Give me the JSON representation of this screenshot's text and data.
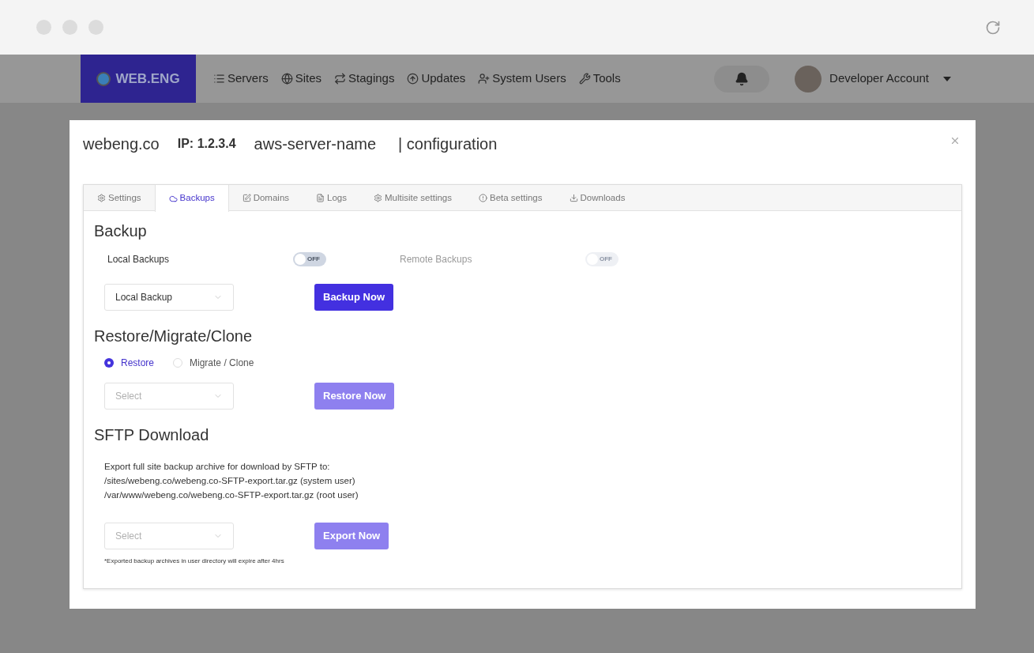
{
  "brand": {
    "name": "WEB.ENG"
  },
  "nav": [
    {
      "label": "Servers"
    },
    {
      "label": "Sites"
    },
    {
      "label": "Stagings"
    },
    {
      "label": "Updates"
    },
    {
      "label": "System Users"
    },
    {
      "label": "Tools"
    }
  ],
  "account": {
    "name": "Developer Account"
  },
  "modal": {
    "domain": "webeng.co",
    "ip": "IP: 1.2.3.4",
    "server": "aws-server-name",
    "section": "| configuration"
  },
  "tabs": [
    {
      "label": "Settings",
      "selected": false
    },
    {
      "label": "Backups",
      "selected": true
    },
    {
      "label": "Domains",
      "selected": false
    },
    {
      "label": "Logs",
      "selected": false
    },
    {
      "label": "Multisite settings",
      "selected": false
    },
    {
      "label": "Beta settings",
      "selected": false
    },
    {
      "label": "Downloads",
      "selected": false
    }
  ],
  "backup": {
    "title": "Backup",
    "toggles": [
      {
        "label": "Local Backups",
        "state": "OFF",
        "on": false,
        "disabled": false
      },
      {
        "label": "Remote Backups",
        "state": "OFF",
        "on": false,
        "disabled": true
      }
    ],
    "select": {
      "value": "Local Backup"
    },
    "button": {
      "label": "Backup Now",
      "disabled": false
    }
  },
  "restore": {
    "title": "Restore/Migrate/Clone",
    "radios": [
      {
        "label": "Restore",
        "selected": true
      },
      {
        "label": "Migrate / Clone",
        "selected": false
      }
    ],
    "select": {
      "placeholder": "Select"
    },
    "button": {
      "label": "Restore Now",
      "disabled": true
    }
  },
  "sftp": {
    "title": "SFTP Download",
    "lines": [
      "Export full site backup archive for download by SFTP to:",
      "/sites/webeng.co/webeng.co-SFTP-export.tar.gz (system user)",
      "/var/www/webeng.co/webeng.co-SFTP-export.tar.gz (root user)"
    ],
    "select": {
      "placeholder": "Select"
    },
    "button": {
      "label": "Export Now",
      "disabled": true
    },
    "note": "*Exported backup archives in user directory will expire after 4hrs"
  }
}
